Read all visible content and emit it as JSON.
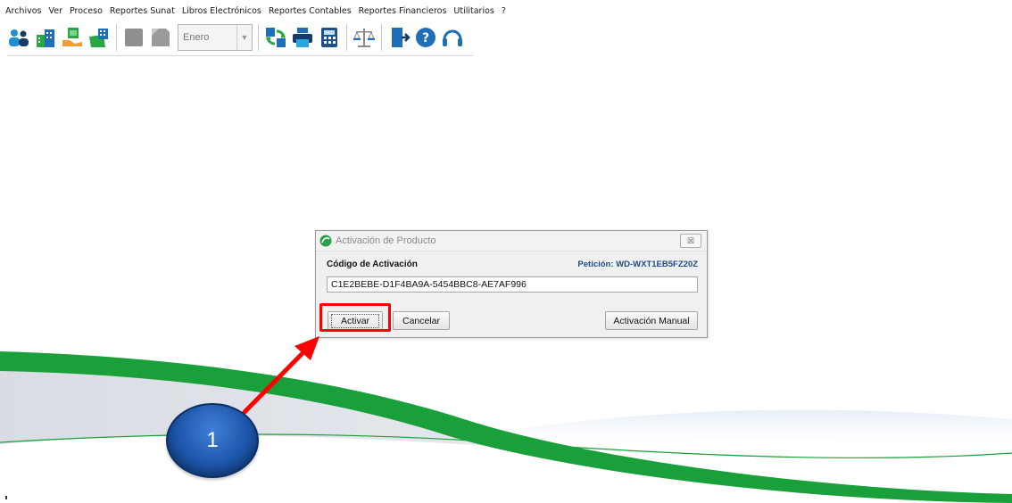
{
  "menu": {
    "items": [
      "Archivos",
      "Ver",
      "Proceso",
      "Reportes Sunat",
      "Libros Electrónicos",
      "Reportes Contables",
      "Reportes Financieros",
      "Utilitarios",
      "?"
    ]
  },
  "toolbar": {
    "month": "Enero",
    "icons": [
      "users-icon",
      "buildings-icon",
      "person-money-icon",
      "company-card-icon",
      "gray-square-icon",
      "gray-folded-icon",
      "sync-icon",
      "printer-icon",
      "calculator-icon",
      "balance-scale-icon",
      "exit-door-icon",
      "help-icon",
      "headset-icon"
    ]
  },
  "dialog": {
    "title": "Activación de Producto",
    "code_label": "Código de Activación",
    "request_label": "Petición: WD-WXT1EB5FZ20Z",
    "code_value": "C1E2BEBE-D1F4BA9A-5454BBC8-AE7AF996",
    "activate_label": "Activar",
    "cancel_label": "Cancelar",
    "manual_label": "Activación Manual",
    "close_label": "☒"
  },
  "annotation": {
    "step": "1"
  },
  "colors": {
    "highlight": "#ff0000",
    "badge": "#1d56aa",
    "wave_green": "#1aa03a",
    "request_text": "#1f4a86"
  }
}
